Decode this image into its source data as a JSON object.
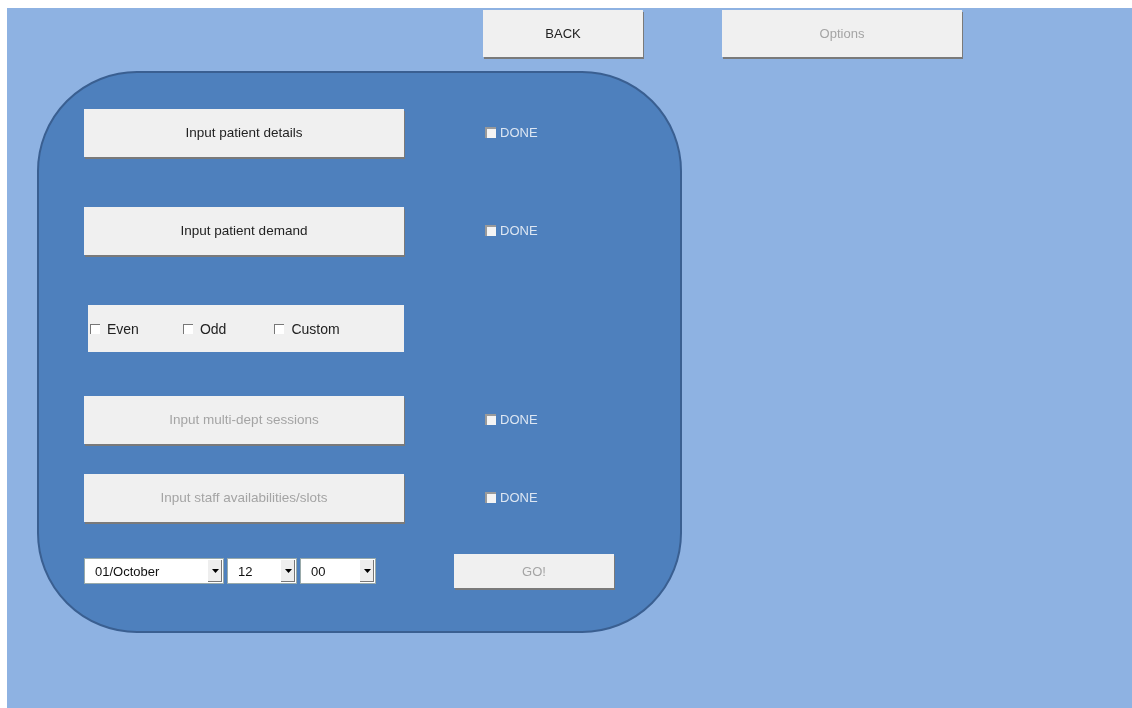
{
  "top_buttons": [
    {
      "label": "BACK",
      "disabled": false
    },
    {
      "label": "Options",
      "disabled": true
    }
  ],
  "panel": {
    "rows": [
      {
        "kind": "task",
        "label": "Input patient details",
        "disabled": false,
        "done": {
          "label": "DONE",
          "checked": false
        }
      },
      {
        "kind": "task",
        "label": "Input patient demand",
        "disabled": false,
        "done": {
          "label": "DONE",
          "checked": false
        }
      },
      {
        "kind": "choices",
        "options": [
          {
            "label": "Even",
            "checked": false
          },
          {
            "label": "Odd",
            "checked": false
          },
          {
            "label": "Custom",
            "checked": false
          }
        ]
      },
      {
        "kind": "task",
        "label": "Input multi-dept sessions",
        "disabled": true,
        "done": {
          "label": "DONE",
          "checked": false
        }
      },
      {
        "kind": "task",
        "label": "Input staff availabilities/slots",
        "disabled": true,
        "done": {
          "label": "DONE",
          "checked": false
        }
      },
      {
        "kind": "schedule",
        "selects": [
          {
            "value": "01/October"
          },
          {
            "value": "12"
          },
          {
            "value": "00"
          }
        ],
        "go": {
          "label": "GO!",
          "disabled": true
        }
      }
    ]
  }
}
